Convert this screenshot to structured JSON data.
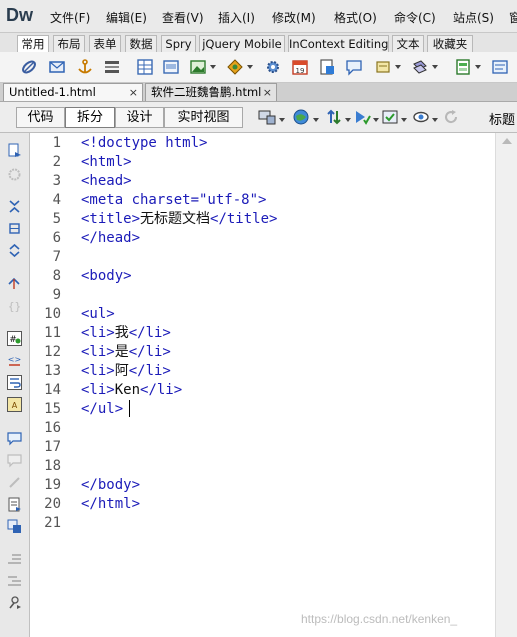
{
  "app": {
    "logo": "Dw"
  },
  "menubar": {
    "items": [
      "文件(F)",
      "编辑(E)",
      "查看(V)",
      "插入(I)",
      "修改(M)",
      "格式(O)",
      "命令(C)",
      "站点(S)",
      "窗"
    ]
  },
  "insert_tabs": [
    "常用",
    "布局",
    "表单",
    "数据",
    "Spry",
    "jQuery Mobile",
    "InContext Editing",
    "文本",
    "收藏夹"
  ],
  "insert_icons": [
    "hyperlink-icon",
    "email-link-icon",
    "named-anchor-icon",
    "horizontal-rule-icon",
    "table-icon",
    "insert-div-icon",
    "image-icon",
    "media-icon",
    "widget-icon",
    "date-icon",
    "server-side-include-icon",
    "comment-icon",
    "head-icon",
    "script-icon",
    "templates-icon",
    "tag-chooser-icon"
  ],
  "doc_tabs": [
    {
      "label": "Untitled-1.html",
      "close": "×"
    },
    {
      "label": "软件二班魏鲁鹏.html",
      "close": "×"
    }
  ],
  "doc_toolbar": {
    "view_buttons": [
      "代码",
      "拆分",
      "设计",
      "实时视图"
    ],
    "title_label": "标题"
  },
  "code": {
    "line_numbers": [
      "1",
      "2",
      "3",
      "4",
      "5",
      "6",
      "7",
      "8",
      "9",
      "10",
      "11",
      "12",
      "13",
      "14",
      "15",
      "16",
      "17",
      "18",
      "19",
      "20",
      "21"
    ],
    "lines": [
      "<!doctype html>",
      "<html>",
      "<head>",
      "<meta charset=\"utf-8\">",
      "<title>无标题文档</title>",
      "</head>",
      "",
      "<body>",
      "",
      "<ul>",
      "<li>我</li>",
      "<li>是</li>",
      "<li>阿</li>",
      "<li>Ken</li>",
      "</ul>",
      "",
      "",
      "",
      "</body>",
      "</html>",
      ""
    ]
  },
  "watermark": "https://blog.csdn.net/kenken_",
  "colors": {
    "tag": "#1b1bb8",
    "text": "#111111",
    "line_number": "#555555"
  }
}
